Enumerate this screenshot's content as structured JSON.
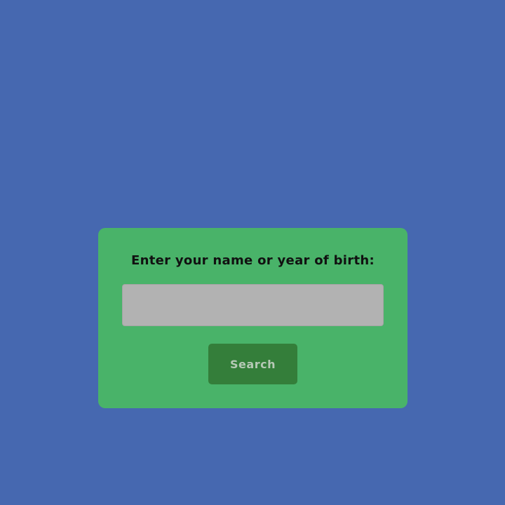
{
  "search_form": {
    "prompt": "Enter your name or year of birth:",
    "input_value": "",
    "input_placeholder": "",
    "button_label": "Search"
  },
  "colors": {
    "background": "#4668b0",
    "card": "#49b369",
    "input": "#b2b2b2",
    "button": "#347e3a",
    "button_text": "#b6c9b6"
  }
}
